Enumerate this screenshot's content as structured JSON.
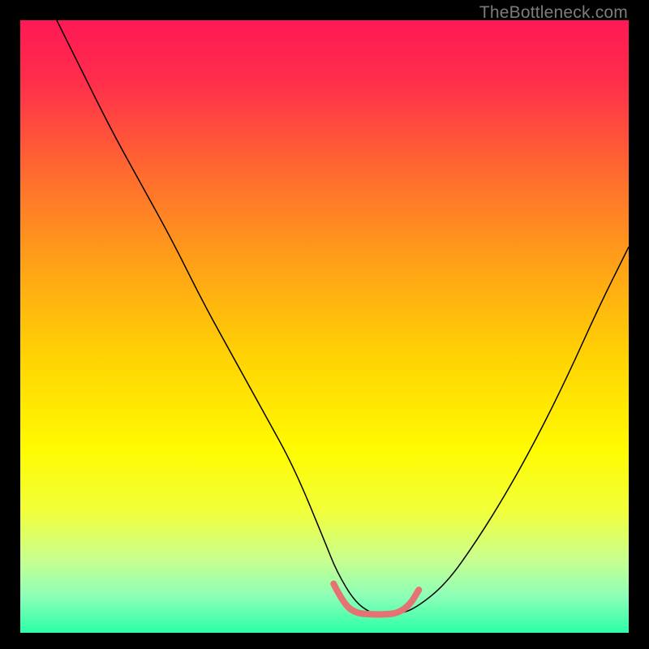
{
  "watermark": "TheBottleneck.com",
  "chart_data": {
    "type": "line",
    "title": "",
    "xlabel": "",
    "ylabel": "",
    "xlim": [
      0,
      100
    ],
    "ylim": [
      0,
      100
    ],
    "grid": false,
    "legend": false,
    "background_gradient": {
      "orientation": "vertical",
      "stops": [
        {
          "pos": 0.0,
          "color": "#ff1955"
        },
        {
          "pos": 0.1,
          "color": "#ff2e4b"
        },
        {
          "pos": 0.25,
          "color": "#ff6b2f"
        },
        {
          "pos": 0.4,
          "color": "#ffa217"
        },
        {
          "pos": 0.55,
          "color": "#ffd304"
        },
        {
          "pos": 0.7,
          "color": "#fffb00"
        },
        {
          "pos": 0.8,
          "color": "#f2ff3a"
        },
        {
          "pos": 0.88,
          "color": "#c9ff8e"
        },
        {
          "pos": 0.94,
          "color": "#8dffb8"
        },
        {
          "pos": 1.0,
          "color": "#2bffa7"
        }
      ]
    },
    "series": [
      {
        "name": "bottleneck-curve",
        "color": "#000000",
        "width": 1.5,
        "x": [
          6,
          10,
          15,
          20,
          25,
          30,
          35,
          40,
          45,
          50,
          52,
          55,
          58,
          60,
          62,
          65,
          70,
          75,
          80,
          85,
          90,
          95,
          100
        ],
        "y": [
          100,
          92,
          82,
          73,
          64,
          54,
          45,
          36,
          27,
          15,
          10,
          5,
          3,
          3,
          3,
          4,
          8,
          15,
          23,
          32,
          42,
          53,
          63
        ]
      },
      {
        "name": "optimal-zone-marker",
        "color": "#e57373",
        "width": 8,
        "cap": "round",
        "x": [
          51.5,
          53,
          55,
          58,
          60,
          62,
          64,
          65.5
        ],
        "y": [
          8,
          5,
          3.2,
          3,
          3,
          3.2,
          4.5,
          7
        ]
      }
    ]
  }
}
